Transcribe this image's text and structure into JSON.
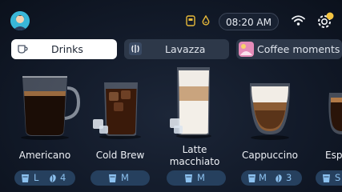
{
  "status": {
    "time": "08:20 AM",
    "icons": [
      "avatar",
      "maintenance-icon",
      "water-filter-icon",
      "wifi-icon",
      "settings-gear-icon"
    ]
  },
  "chips": [
    {
      "label": "Drinks",
      "icon": "cup-icon",
      "selected": true
    },
    {
      "label": "Lavazza",
      "icon": "lavazza-logo-icon",
      "selected": false
    },
    {
      "label": "Coffee moments",
      "icon": "coffee-moments-icon",
      "selected": false
    }
  ],
  "drinks": [
    {
      "name": "Americano",
      "size": "L",
      "strength": "4"
    },
    {
      "name": "Cold Brew",
      "size": "M",
      "strength": ""
    },
    {
      "name": "Latte macchiato",
      "size": "M",
      "strength": ""
    },
    {
      "name": "Cappuccino",
      "size": "M",
      "strength": "3"
    },
    {
      "name": "Esp",
      "size": "S",
      "strength": ""
    }
  ],
  "colors": {
    "accent": "#8cc1ef",
    "badge": "#26405e",
    "chip": "#2d3849",
    "selected_chip": "#ffffff",
    "notification": "#f4c542"
  }
}
